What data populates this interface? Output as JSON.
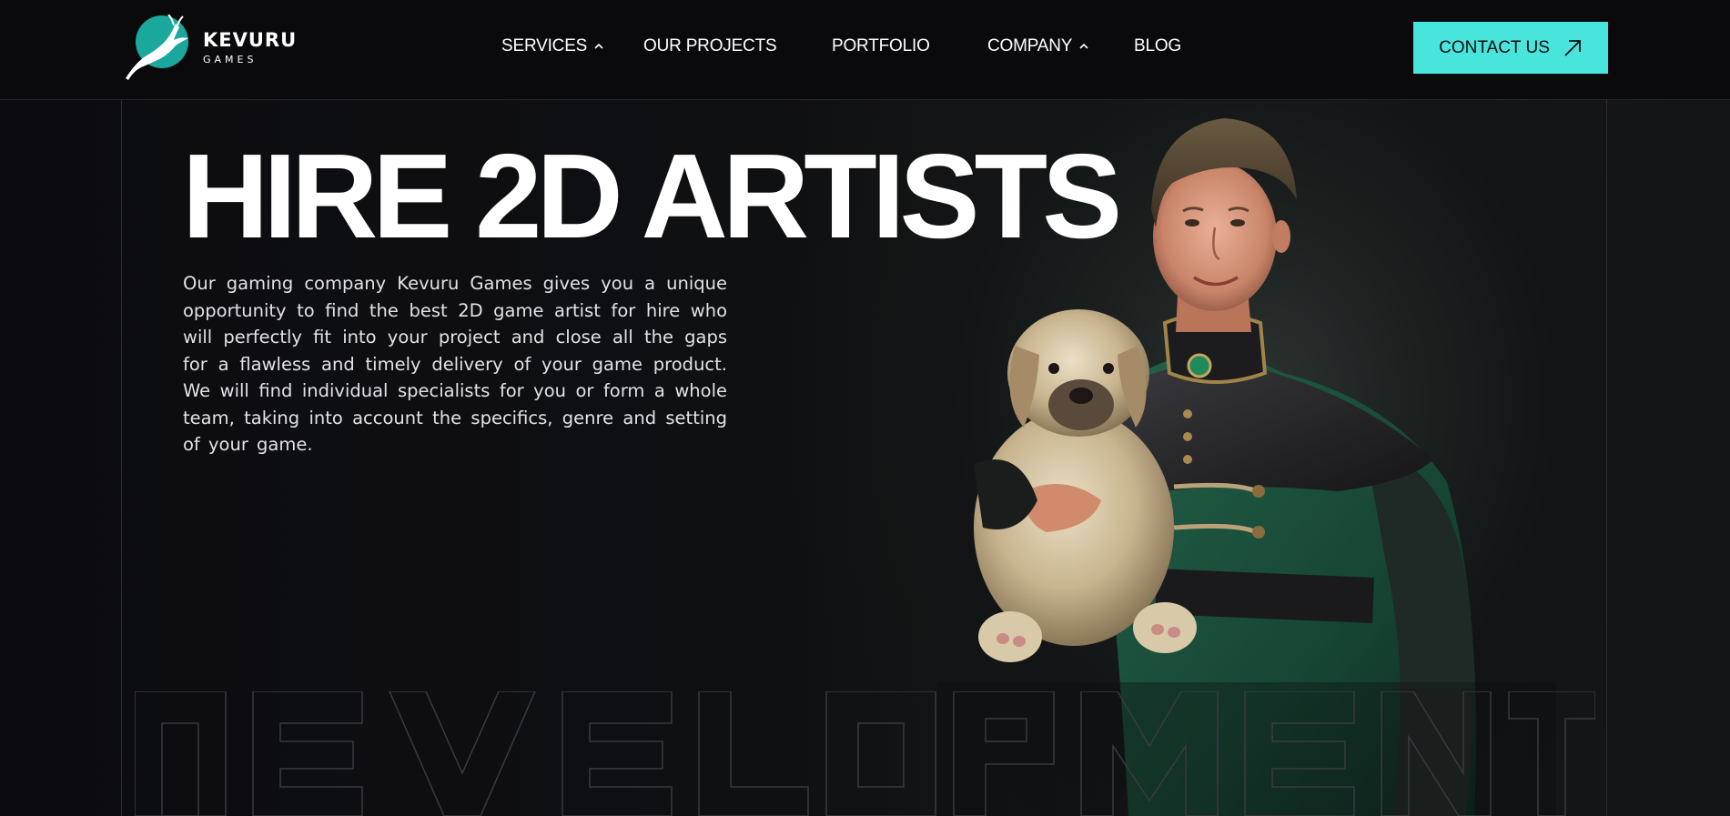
{
  "brand": {
    "name": "KEVURU",
    "sub": "GAMES",
    "logo_icon": "antelope-leaping-icon",
    "accent_color": "#48e5dc"
  },
  "nav": {
    "items": [
      {
        "label": "SERVICES",
        "has_dropdown": true
      },
      {
        "label": "OUR PROJECTS",
        "has_dropdown": false
      },
      {
        "label": "PORTFOLIO",
        "has_dropdown": false
      },
      {
        "label": "COMPANY",
        "has_dropdown": true
      },
      {
        "label": "BLOG",
        "has_dropdown": false
      }
    ],
    "cta_label": "CONTACT US",
    "cta_icon": "arrow-up-right-icon"
  },
  "hero": {
    "title": "HIRE 2D ARTISTS",
    "description": "Our gaming company Kevuru Games gives you a unique opportunity to find the best 2D game artist for hire who will perfectly fit into your project and close all the gaps for a flawless and timely delivery of your game product. We will find individual specialists for you or form a whole team, taking into account the specifics, genre and setting of your game.",
    "illustration": "young-man-in-green-tunic-holding-puppy",
    "watermark_text": "DEVELOPMENT"
  }
}
